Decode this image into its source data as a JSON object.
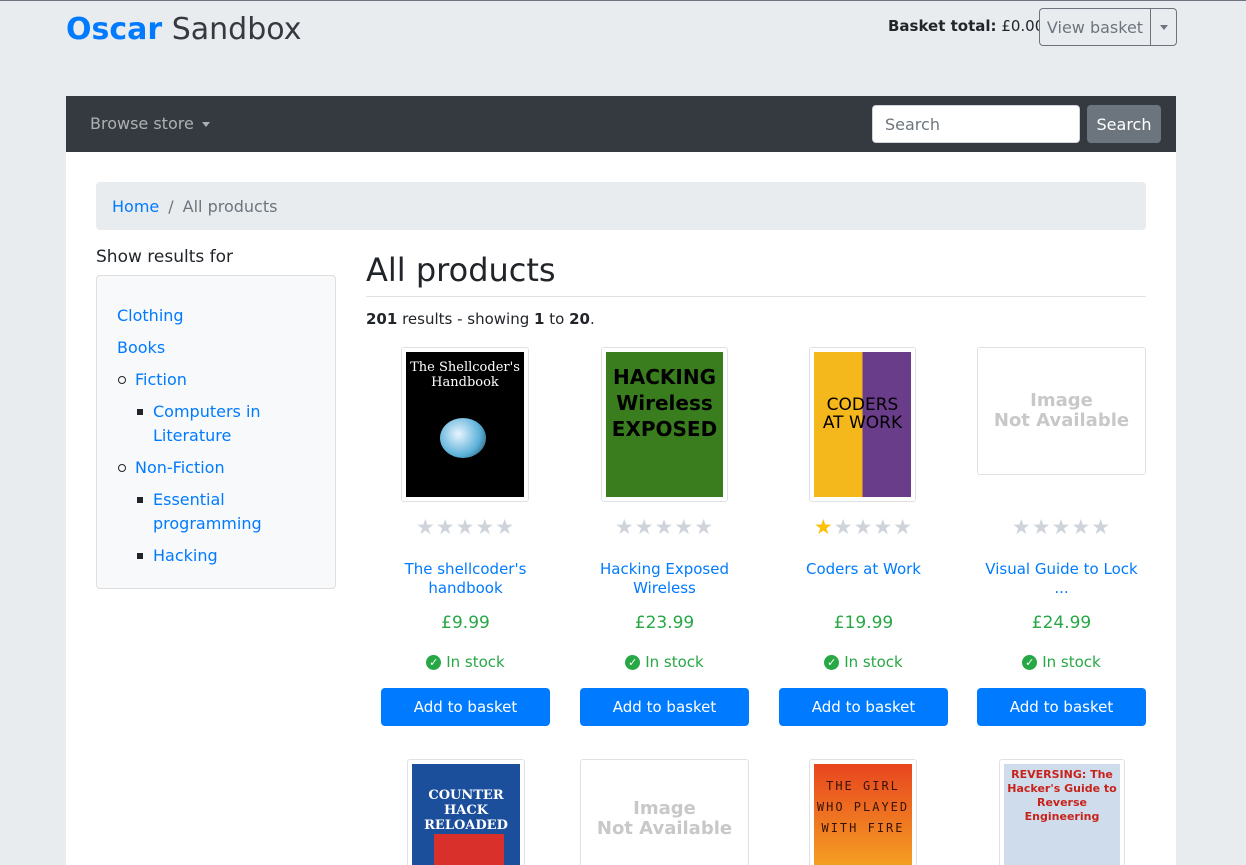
{
  "header": {
    "brand_primary": "Oscar",
    "brand_secondary": "Sandbox",
    "basket_total_label": "Basket total:",
    "basket_total_value": "£0.00",
    "view_basket_label": "View basket"
  },
  "navbar": {
    "browse_label": "Browse store",
    "search_placeholder": "Search",
    "search_button": "Search"
  },
  "breadcrumb": {
    "home": "Home",
    "separator": "/",
    "current": "All products"
  },
  "sidebar": {
    "title": "Show results for",
    "categories": [
      {
        "label": "Clothing",
        "level": 0
      },
      {
        "label": "Books",
        "level": 0
      },
      {
        "label": "Fiction",
        "level": 1
      },
      {
        "label": "Computers in",
        "label2": "Literature",
        "level": 2
      },
      {
        "label": "Non-Fiction",
        "level": 1
      },
      {
        "label": "Essential",
        "label2": "programming",
        "level": 2
      },
      {
        "label": "Hacking",
        "level": 2
      }
    ]
  },
  "main": {
    "title": "All products",
    "results_count": "201",
    "results_text": "results - showing",
    "range_start": "1",
    "range_to": "to",
    "range_end": "20",
    "range_period": "."
  },
  "products": [
    {
      "name_line1": "The shellcoder's",
      "name_line2": "handbook",
      "price": "£9.99",
      "availability": "In stock",
      "rating": 0,
      "button": "Add to basket",
      "cover_text": "The Shellcoder's Handbook"
    },
    {
      "name_line1": "Hacking Exposed",
      "name_line2": "Wireless",
      "price": "£23.99",
      "availability": "In stock",
      "rating": 0,
      "button": "Add to basket",
      "cover_text": "HACKING Wireless EXPOSED"
    },
    {
      "name_line1": "Coders at Work",
      "name_line2": "",
      "price": "£19.99",
      "availability": "In stock",
      "rating": 1,
      "button": "Add to basket",
      "cover_text": "CODERS AT WORK"
    },
    {
      "name_line1": "Visual Guide to Lock ...",
      "name_line2": "",
      "price": "£24.99",
      "availability": "In stock",
      "rating": 0,
      "button": "Add to basket",
      "placeholder_line1": "Image",
      "placeholder_line2": "Not Available"
    }
  ],
  "second_row": [
    {
      "cover_text": "COUNTER HACK RELOADED"
    },
    {
      "placeholder_line1": "Image",
      "placeholder_line2": "Not Available"
    },
    {
      "cover_text": "THE GIRL WHO PLAYED WITH FIRE"
    },
    {
      "cover_text": "REVERSING: The Hacker's Guide to Reverse Engineering"
    }
  ],
  "colors": {
    "primary": "#007bff",
    "success": "#28a745",
    "navbar": "#343a40",
    "star_on": "#ffc107",
    "star_off": "#ced4da"
  }
}
